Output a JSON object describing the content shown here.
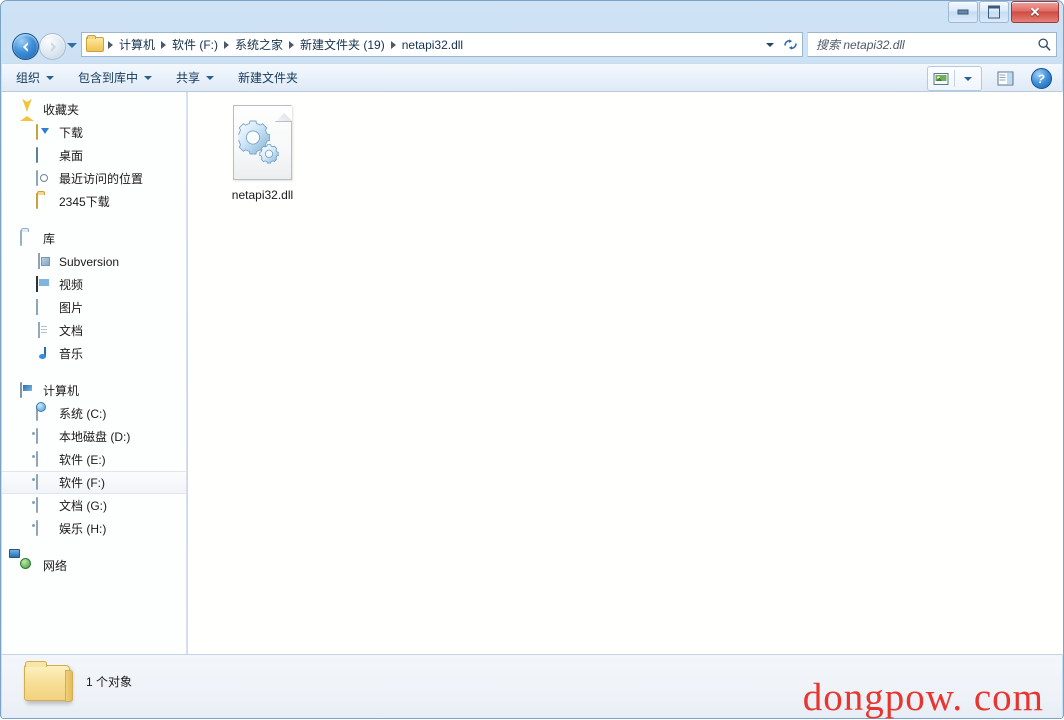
{
  "window": {
    "controls": {
      "minimize": "—",
      "maximize": "□",
      "close": "✕"
    }
  },
  "addressbar": {
    "back_tooltip": "后退",
    "forward_tooltip": "前进",
    "breadcrumbs": [
      "计算机",
      "软件 (F:)",
      "系统之家",
      "新建文件夹 (19)",
      "netapi32.dll"
    ],
    "refresh_label": "↻",
    "search_placeholder": "搜索 netapi32.dll",
    "search_value": ""
  },
  "toolbar": {
    "items": [
      {
        "label": "组织",
        "has_caret": true
      },
      {
        "label": "包含到库中",
        "has_caret": true
      },
      {
        "label": "共享",
        "has_caret": true
      },
      {
        "label": "新建文件夹",
        "has_caret": false
      }
    ],
    "help_label": "?"
  },
  "sidebar": {
    "groups": [
      {
        "header": {
          "label": "收藏夹",
          "icon": "star-icon"
        },
        "items": [
          {
            "label": "下载",
            "icon": "downloads-icon"
          },
          {
            "label": "桌面",
            "icon": "desktop-icon"
          },
          {
            "label": "最近访问的位置",
            "icon": "recent-places-icon"
          },
          {
            "label": "2345下载",
            "icon": "folder-icon"
          }
        ]
      },
      {
        "header": {
          "label": "库",
          "icon": "library-icon"
        },
        "items": [
          {
            "label": "Subversion",
            "icon": "subversion-icon"
          },
          {
            "label": "视频",
            "icon": "video-icon"
          },
          {
            "label": "图片",
            "icon": "picture-icon"
          },
          {
            "label": "文档",
            "icon": "document-icon"
          },
          {
            "label": "音乐",
            "icon": "music-icon"
          }
        ]
      },
      {
        "header": {
          "label": "计算机",
          "icon": "computer-icon"
        },
        "items": [
          {
            "label": "系统 (C:)",
            "icon": "system-drive-icon",
            "selected": false
          },
          {
            "label": "本地磁盘 (D:)",
            "icon": "drive-icon",
            "selected": false
          },
          {
            "label": "软件 (E:)",
            "icon": "drive-icon",
            "selected": false
          },
          {
            "label": "软件 (F:)",
            "icon": "drive-icon",
            "selected": true
          },
          {
            "label": "文档 (G:)",
            "icon": "drive-icon",
            "selected": false
          },
          {
            "label": "娱乐 (H:)",
            "icon": "drive-icon",
            "selected": false
          }
        ]
      },
      {
        "header": {
          "label": "网络",
          "icon": "network-icon"
        },
        "items": []
      }
    ]
  },
  "content": {
    "files": [
      {
        "name": "netapi32.dll",
        "icon": "dll-file-icon"
      }
    ]
  },
  "statusbar": {
    "item_count_text": "1 个对象"
  },
  "watermark": {
    "text": "dongpow. com",
    "color": "#e8352e"
  }
}
